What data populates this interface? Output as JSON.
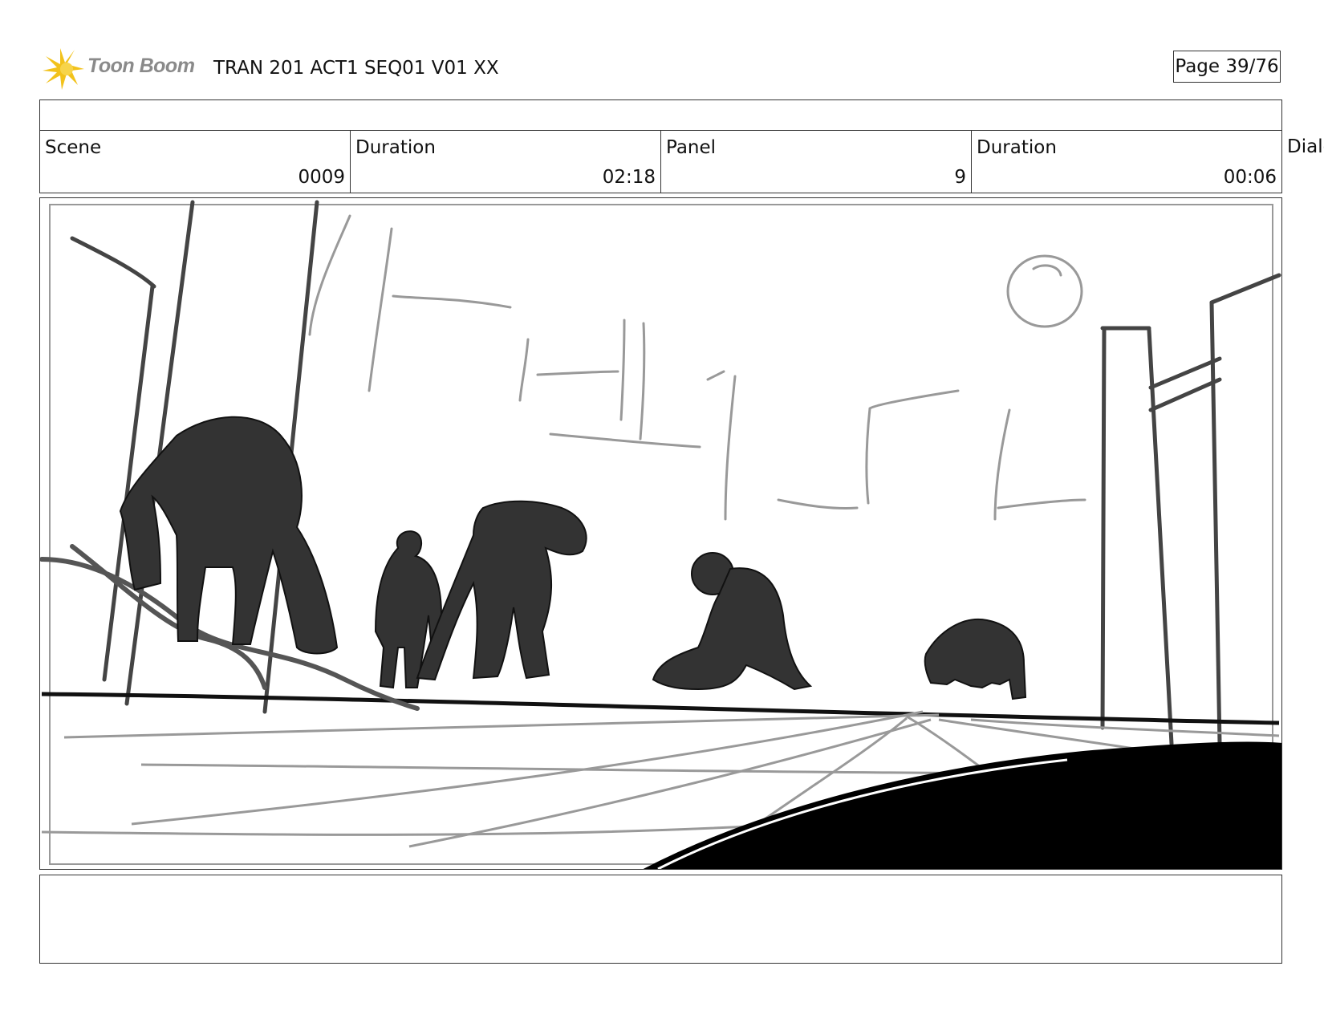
{
  "header": {
    "logo_text": "Toon Boom",
    "title": "TRAN 201 ACT1 SEQ01 V01 XX",
    "page": "Page 39/76"
  },
  "info": {
    "scene_label": "Scene",
    "scene_value": "0009",
    "scene_duration_label": "Duration",
    "scene_duration_value": "02:18",
    "panel_label": "Panel",
    "panel_value": "9",
    "panel_duration_label": "Duration",
    "panel_duration_value": "00:06",
    "dialog_label": "Dialo"
  },
  "colors": {
    "logo_accent": "#f2c21b",
    "silhouette": "#333333",
    "sketch_gray": "#999999",
    "border": "#333333"
  }
}
